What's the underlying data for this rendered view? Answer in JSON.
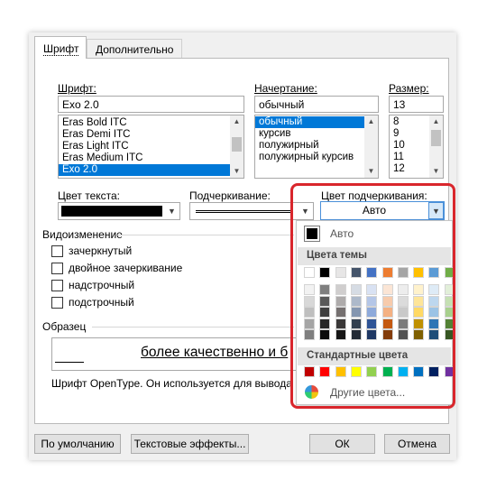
{
  "tabs": [
    {
      "label": "Шрифт"
    },
    {
      "label": "Дополнительно"
    }
  ],
  "font": {
    "label": "Шрифт:",
    "value": "Exo 2.0",
    "list": [
      "Eras Bold ITC",
      "Eras Demi ITC",
      "Eras Light ITC",
      "Eras Medium ITC",
      "Exo 2.0"
    ]
  },
  "style": {
    "label": "Начертание:",
    "value": "обычный",
    "list": [
      "обычный",
      "курсив",
      "полужирный",
      "полужирный курсив"
    ]
  },
  "size": {
    "label": "Размер:",
    "value": "13",
    "list": [
      "8",
      "9",
      "10",
      "11",
      "12"
    ]
  },
  "text_color": {
    "label": "Цвет текста:",
    "value_color": "#000000"
  },
  "underline": {
    "label": "Подчеркивание:"
  },
  "underline_color": {
    "label": "Цвет подчеркивания:",
    "value": "Авто"
  },
  "effects": {
    "label": "Видоизменение",
    "items": [
      "зачеркнутый",
      "двойное зачеркивание",
      "надстрочный",
      "подстрочный"
    ]
  },
  "preview": {
    "label": "Образец",
    "sample_text": "более качественно и б",
    "description": "Шрифт OpenType. Он используется для вывода к"
  },
  "buttons": {
    "default": "По умолчанию",
    "text_effects": "Текстовые эффекты...",
    "ok": "ОК",
    "cancel": "Отмена"
  },
  "color_menu": {
    "auto_label": "Авто",
    "theme_label": "Цвета темы",
    "standard_label": "Стандартные цвета",
    "more_label": "Другие цвета...",
    "theme_top": [
      "#ffffff",
      "#000000",
      "#e7e6e6",
      "#44546a",
      "#4472c4",
      "#ed7d31",
      "#a5a5a5",
      "#ffc000",
      "#5b9bd5",
      "#70ad47"
    ],
    "theme_shades": [
      [
        "#f2f2f2",
        "#7f7f7f",
        "#d0cece",
        "#d6dce4",
        "#d9e2f3",
        "#fbe5d5",
        "#ededed",
        "#fff2cc",
        "#deebf6",
        "#e2efd9"
      ],
      [
        "#d8d8d8",
        "#595959",
        "#aeabab",
        "#adb9ca",
        "#b4c6e7",
        "#f7cbac",
        "#dbdbdb",
        "#fee599",
        "#bdd7ee",
        "#c5e0b3"
      ],
      [
        "#bfbfbf",
        "#3f3f3f",
        "#757070",
        "#8496b0",
        "#8eaadb",
        "#f4b183",
        "#c9c9c9",
        "#ffd965",
        "#9cc3e5",
        "#a8d08d"
      ],
      [
        "#a5a5a5",
        "#262626",
        "#3a3838",
        "#323f4f",
        "#2f5496",
        "#c45911",
        "#7b7b7b",
        "#bf9000",
        "#2e75b5",
        "#538135"
      ],
      [
        "#7f7f7f",
        "#0c0c0c",
        "#171616",
        "#222a35",
        "#1f3864",
        "#833c0b",
        "#525252",
        "#7f6000",
        "#1e4e79",
        "#375623"
      ]
    ],
    "standard": [
      "#c00000",
      "#ff0000",
      "#ffc000",
      "#ffff00",
      "#92d050",
      "#00b050",
      "#00b0f0",
      "#0070c0",
      "#002060",
      "#7030a0"
    ]
  }
}
